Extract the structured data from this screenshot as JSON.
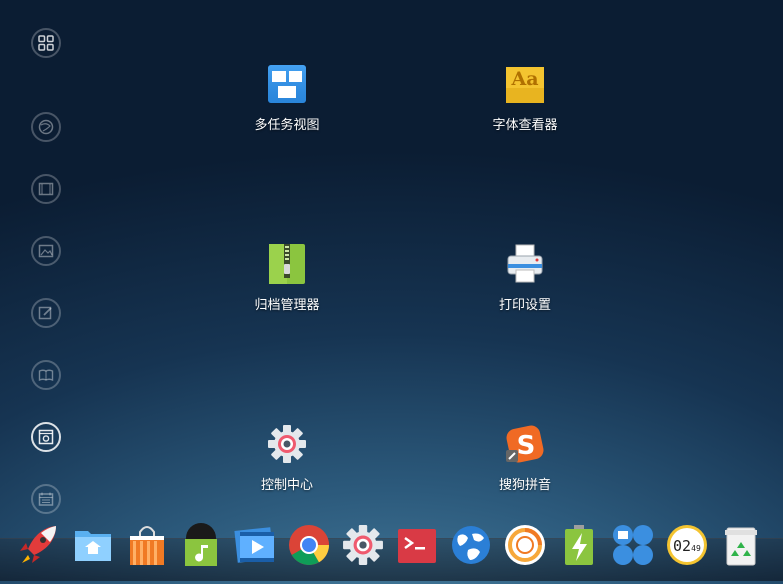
{
  "launcher": {
    "apps": [
      {
        "name": "多任务视图",
        "icon": "multitask-view-icon"
      },
      {
        "name": "字体查看器",
        "icon": "font-viewer-icon"
      },
      {
        "name": "归档管理器",
        "icon": "archive-manager-icon"
      },
      {
        "name": "打印设置",
        "icon": "printer-settings-icon"
      },
      {
        "name": "控制中心",
        "icon": "control-center-icon"
      },
      {
        "name": "搜狗拼音",
        "icon": "sogou-pinyin-icon"
      }
    ]
  },
  "sidebar": {
    "items": [
      "grid-icon",
      "internet-icon",
      "video-icon",
      "image-icon",
      "edit-icon",
      "book-icon",
      "system-icon",
      "calendar-icon"
    ],
    "active": "system-icon"
  },
  "dock": {
    "items": [
      "launcher-icon",
      "file-manager-icon",
      "app-store-icon",
      "music-icon",
      "movie-icon",
      "chrome-icon",
      "control-center-icon",
      "terminal-icon",
      "browser-icon",
      "video-recorder-icon",
      "power-icon",
      "multitask-icon",
      "clock-icon",
      "trash-icon"
    ],
    "clock_hours": "02",
    "clock_minutes": "49"
  },
  "colors": {
    "accent_red": "#e23b3b",
    "accent_green": "#8bc53f",
    "accent_blue": "#3b8fe0",
    "accent_orange": "#f07a24"
  }
}
